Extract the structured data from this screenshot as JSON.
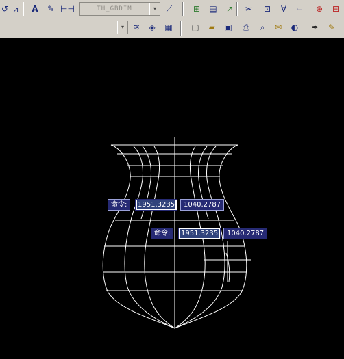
{
  "toolbar_top": {
    "dimstyle_combo": {
      "value": "TH_GBDIM"
    },
    "icons": [
      "dim-continue-icon",
      "dim-quick-icon",
      "text-style-icon",
      "edit-text-icon",
      "dim-linear-icon",
      "update-dim-icon",
      "insert-block-icon",
      "attribute-icon",
      "spline-icon",
      "trim-icon",
      "mirror-icon",
      "vertex-icon",
      "counter-icon",
      "snap-icon"
    ]
  },
  "toolbar_second": {
    "combo_arrow": "▾",
    "icons": [
      "layer-state-icon",
      "layer-stack-icon",
      "layer-match-icon",
      "new-file-icon",
      "open-file-icon",
      "save-icon",
      "print-icon",
      "print-preview-icon",
      "publish-icon",
      "3d-orbit-icon",
      "pen-icon",
      "match-properties-icon"
    ]
  },
  "command_tips": [
    {
      "label": "命令:",
      "x_input": "1951.3235",
      "y_value": "1040.2787"
    },
    {
      "label": "命令:",
      "x_input": "1951.3235",
      "y_value": "1040.2787"
    }
  ],
  "colors": {
    "toolbar_bg": "#d4d0c8",
    "canvas_bg": "#000000",
    "tip_bg": "#262a74",
    "drawing_lines": "#ffffff"
  }
}
